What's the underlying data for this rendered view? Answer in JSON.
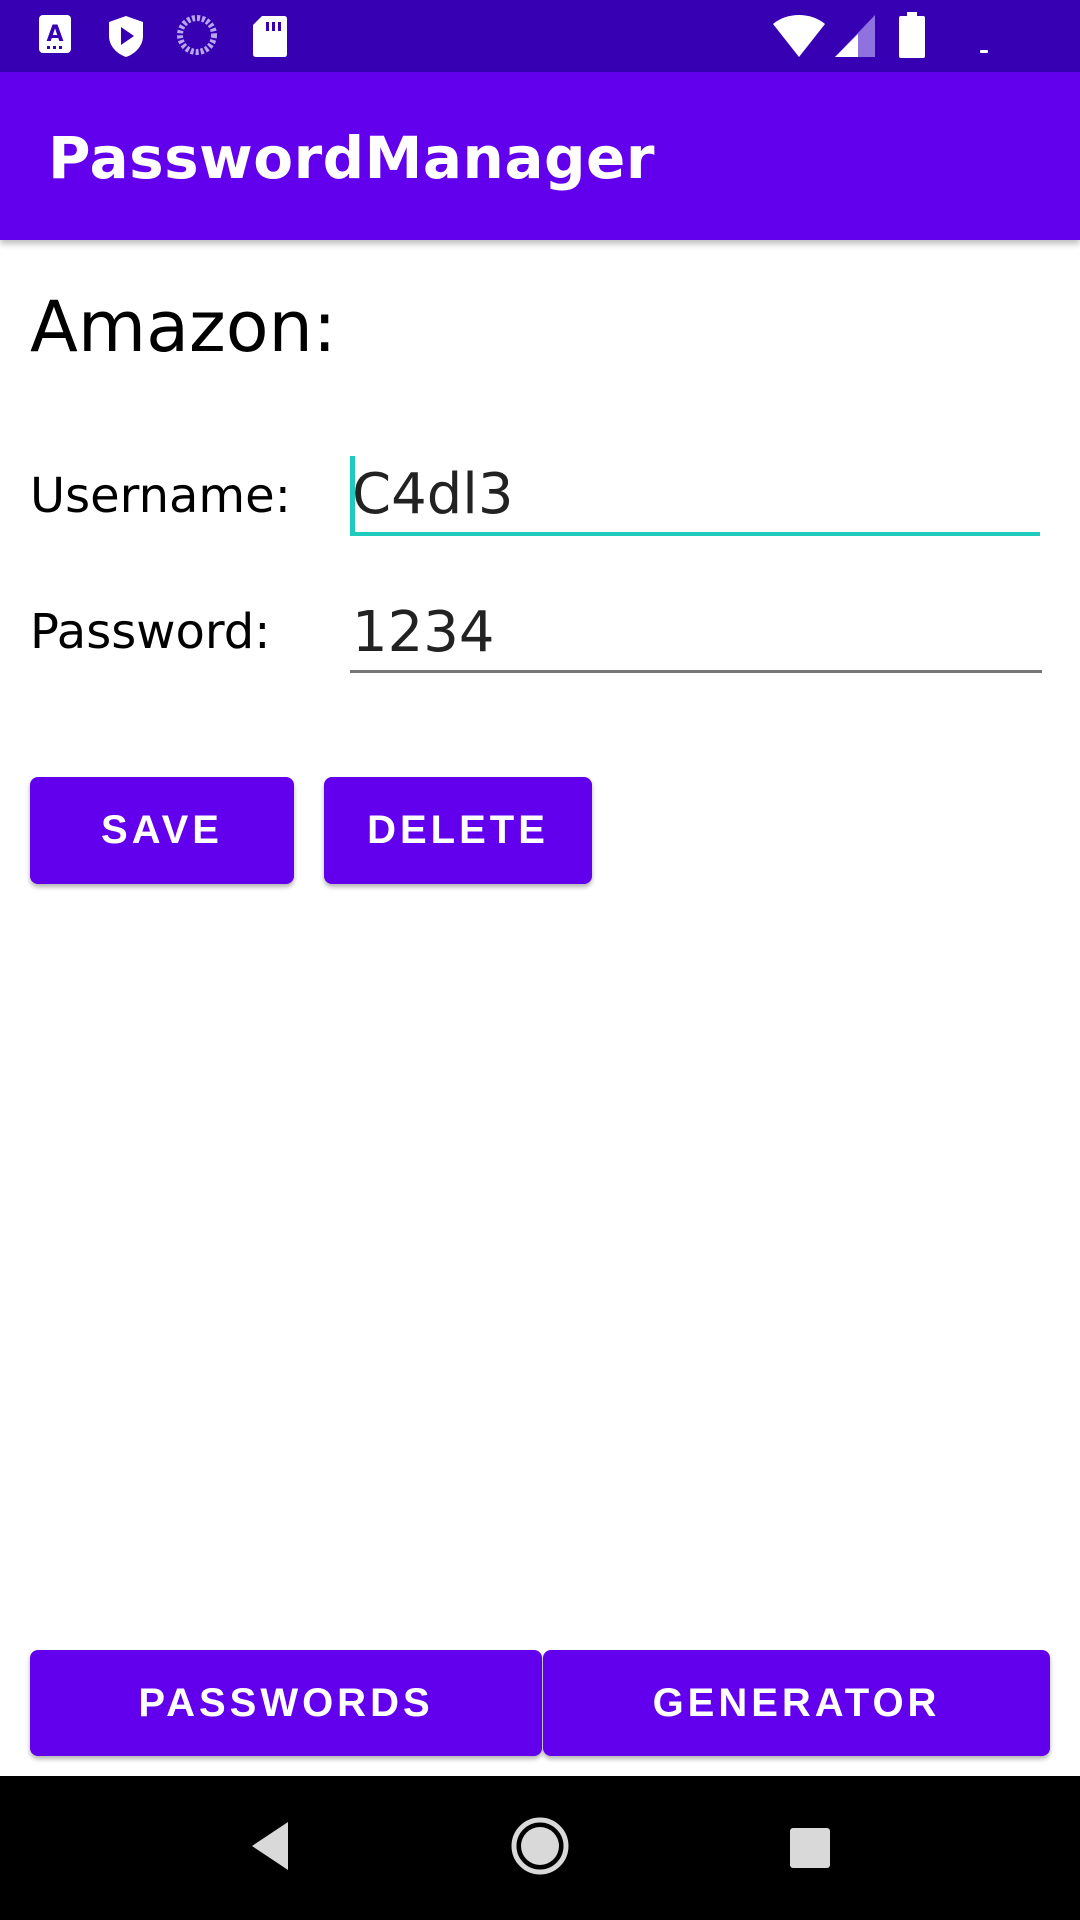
{
  "status_bar": {
    "left_icons": [
      "font-icon",
      "play-shield-icon",
      "sync-icon",
      "sd-card-icon"
    ],
    "right_icons": [
      "wifi-icon",
      "signal-icon",
      "battery-icon"
    ]
  },
  "app_bar": {
    "title": "PasswordManager"
  },
  "entry": {
    "title": "Amazon:",
    "username_label": "Username:",
    "username_value": "C4dl3",
    "password_label": "Password:",
    "password_value": "1234"
  },
  "actions": {
    "save_label": "SAVE",
    "delete_label": "DELETE"
  },
  "bottom_nav": {
    "passwords_label": "PASSWORDS",
    "generator_label": "GENERATOR"
  },
  "system_nav": {
    "icons": [
      "back-icon",
      "home-icon",
      "recent-apps-icon"
    ]
  },
  "colors": {
    "primary": "#6200ee",
    "primary_dark": "#3700b3",
    "accent": "#1ecbbd"
  }
}
